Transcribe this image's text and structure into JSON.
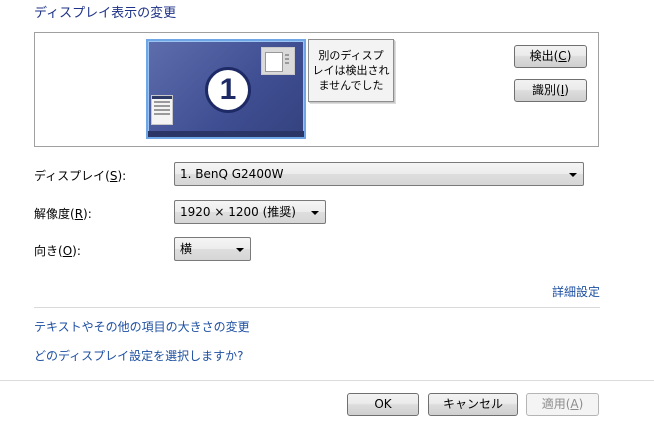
{
  "heading": "ディスプレイ表示の変更",
  "preview": {
    "monitor_number": "1",
    "not_detected_text": "別のディスプ\nレイは検出され\nませんでした",
    "detect_label_prefix": "検出(",
    "detect_accel": "C",
    "detect_label_suffix": ")",
    "identify_label_prefix": "識別(",
    "identify_accel": "I",
    "identify_label_suffix": ")"
  },
  "fields": {
    "display": {
      "label_prefix": "ディスプレイ(",
      "accel": "S",
      "label_suffix": "):",
      "value": "1. BenQ G2400W"
    },
    "resolution": {
      "label_prefix": "解像度(",
      "accel": "R",
      "label_suffix": "):",
      "value": "1920 × 1200 (推奨)"
    },
    "orientation": {
      "label_prefix": "向き(",
      "accel": "O",
      "label_suffix": "):",
      "value": "横"
    }
  },
  "links": {
    "advanced": "詳細設定",
    "text_size": "テキストやその他の項目の大きさの変更",
    "which_settings": "どのディスプレイ設定を選択しますか?"
  },
  "footer": {
    "ok": "OK",
    "cancel": "キャンセル",
    "apply_prefix": "適用(",
    "apply_accel": "A",
    "apply_suffix": ")"
  },
  "colors": {
    "heading": "#1e3287",
    "link": "#1e50a2",
    "monitor_fill": "#4b5a9e",
    "monitor_border": "#6fa6e6"
  },
  "icons": {
    "dropdown": "chevron-down-icon"
  }
}
